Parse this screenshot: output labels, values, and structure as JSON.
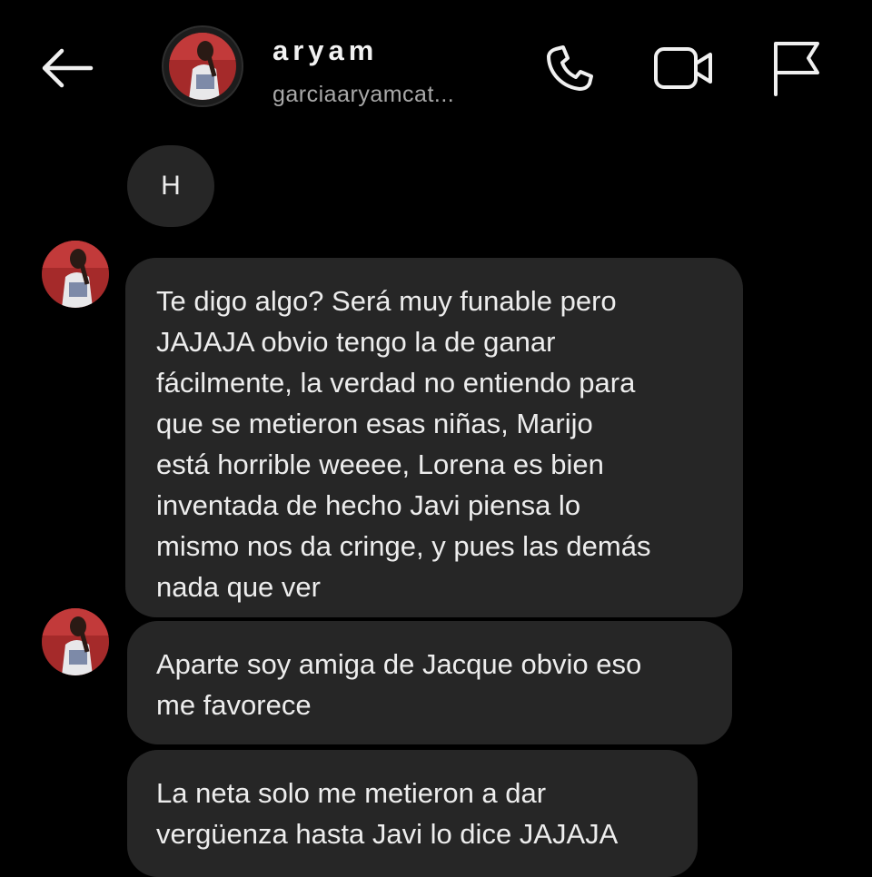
{
  "header": {
    "name": "aryam",
    "username": "garciaaryamcat...",
    "icons": {
      "back": "arrow-left-icon",
      "call": "phone-icon",
      "video": "video-camera-icon",
      "flag": "flag-icon"
    }
  },
  "messages": [
    {
      "text": "H"
    },
    {
      "text": "Te digo algo? Será muy funable pero\nJAJAJA  obvio tengo la de ganar\nfácilmente, la verdad no entiendo para\nque se metieron esas niñas, Marijo\nestá horrible weeee, Lorena es bien\ninventada de hecho Javi piensa lo\nmismo nos da cringe, y pues las demás\nnada que ver"
    },
    {
      "text": "Aparte soy amiga de Jacque obvio eso\nme favorece"
    },
    {
      "text": "La neta solo me metieron a dar\nvergüenza hasta Javi lo dice JAJAJA"
    }
  ],
  "colors": {
    "background": "#000000",
    "bubble": "#262626",
    "text": "#ededed",
    "secondary_text": "#a9a9a9"
  }
}
